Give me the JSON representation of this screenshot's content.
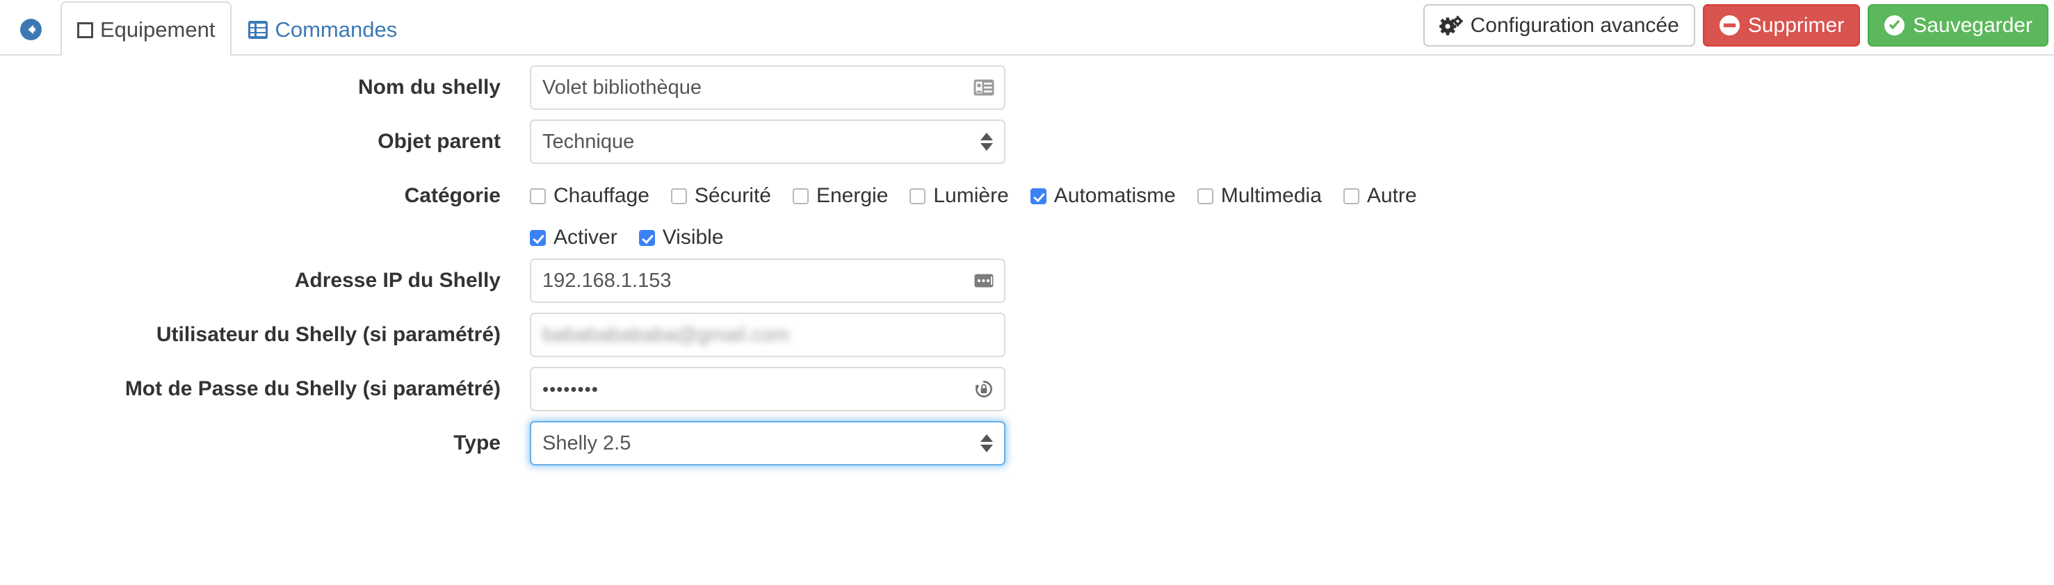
{
  "tabs": {
    "back": {
      "label": "",
      "icon": "arrow-circle-left-icon"
    },
    "items": [
      {
        "id": "equipement",
        "label": "Equipement",
        "icon": "square-icon",
        "active": true
      },
      {
        "id": "commandes",
        "label": "Commandes",
        "icon": "list-icon",
        "active": false
      }
    ]
  },
  "actions": [
    {
      "id": "config-avancee",
      "label": "Configuration avancée",
      "icon": "gears-icon",
      "style": "default"
    },
    {
      "id": "supprimer",
      "label": "Supprimer",
      "icon": "minus-circle-icon",
      "style": "danger"
    },
    {
      "id": "sauvegarder",
      "label": "Sauvegarder",
      "icon": "check-circle-icon",
      "style": "success"
    }
  ],
  "form": {
    "name": {
      "label": "Nom du shelly",
      "value": "Volet bibliothèque",
      "placeholder": "Nom du shelly",
      "addon_icon": "id-card-icon"
    },
    "parent": {
      "label": "Objet parent",
      "value": "Technique",
      "options": [
        "Technique"
      ]
    },
    "category": {
      "label": "Catégorie",
      "options": [
        {
          "label": "Chauffage",
          "checked": false
        },
        {
          "label": "Sécurité",
          "checked": false
        },
        {
          "label": "Energie",
          "checked": false
        },
        {
          "label": "Lumière",
          "checked": false
        },
        {
          "label": "Automatisme",
          "checked": true
        },
        {
          "label": "Multimedia",
          "checked": false
        },
        {
          "label": "Autre",
          "checked": false
        }
      ]
    },
    "flags": [
      {
        "label": "Activer",
        "checked": true
      },
      {
        "label": "Visible",
        "checked": true
      }
    ],
    "ip": {
      "label": "Adresse IP du Shelly",
      "value": "192.168.1.153",
      "placeholder": "Adresse IP du Shelly",
      "addon_icon": "ellipsis-box-icon"
    },
    "user": {
      "label": "Utilisateur du Shelly (si paramétré)",
      "value": "babababababa@gmail.com",
      "placeholder": "Utilisateur du Shelly",
      "redacted": true
    },
    "password": {
      "label": "Mot de Passe du Shelly (si paramétré)",
      "value": "••••••••",
      "placeholder": "Mot de Passe du Shelly",
      "addon_icon": "lock-reset-icon"
    },
    "type": {
      "label": "Type",
      "value": "Shelly 2.5",
      "focused": true,
      "options": [
        "Shelly 2.5"
      ]
    }
  },
  "colors": {
    "link": "#3c79b4",
    "danger": "#d9534f",
    "success": "#5cb85c",
    "checkbox_accent": "#3b82f6",
    "focus_ring": "#66afe9",
    "border": "#dcdcdc"
  }
}
